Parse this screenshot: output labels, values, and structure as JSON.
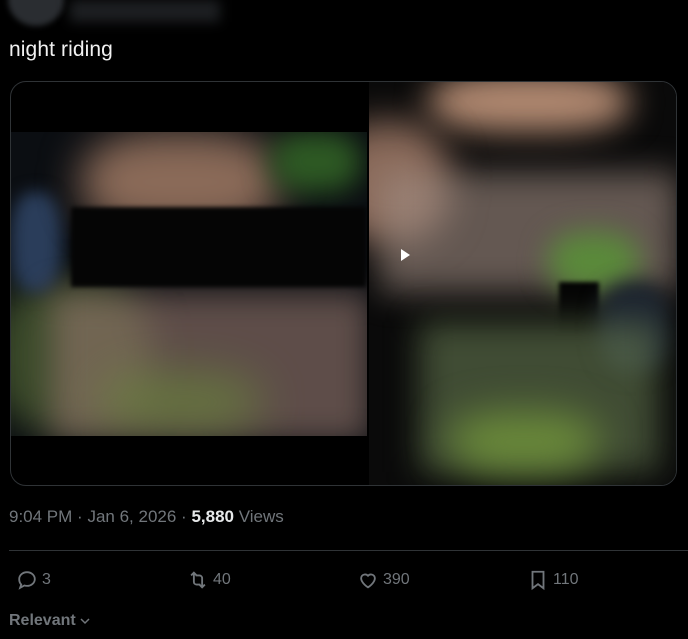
{
  "tweet": {
    "text": "night riding",
    "time": "9:04 PM",
    "date": "Jan 6, 2026",
    "views_count": "5,880",
    "views_label": "Views",
    "separator": "·"
  },
  "media": {
    "left_video_time": "0"
  },
  "actions": {
    "replies": "3",
    "reposts": "40",
    "likes": "390",
    "bookmarks": "110"
  },
  "sort": {
    "label": "Relevant"
  },
  "colors": {
    "background": "#000000",
    "text": "#e7e9ea",
    "muted": "#71767b",
    "border": "#2f3336"
  }
}
